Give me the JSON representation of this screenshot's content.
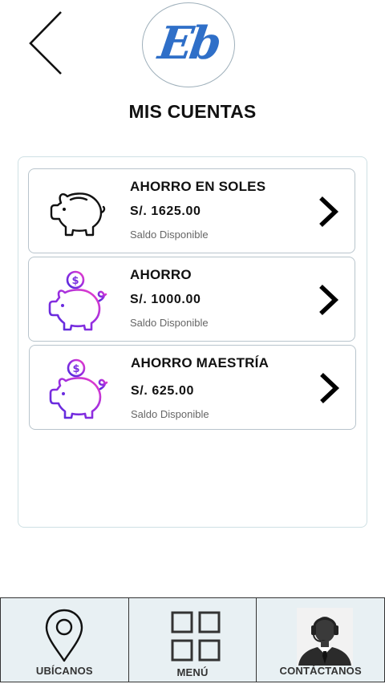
{
  "header": {
    "back_icon": "chevron-left-icon",
    "logo_text": "Eb",
    "title": "MIS CUENTAS"
  },
  "accounts": [
    {
      "name": "AHORRO EN SOLES",
      "amount": "S/.  1625.00",
      "caption": "Saldo Disponible",
      "icon": "piggy-bank-outline-icon"
    },
    {
      "name": "AHORRO",
      "amount": "S/.  1000.00",
      "caption": "Saldo Disponible",
      "icon": "piggy-bank-coin-icon"
    },
    {
      "name": "AHORRO MAESTRÍA",
      "amount": "S/. 625.00",
      "caption": "Saldo Disponible",
      "icon": "piggy-bank-coin-icon"
    }
  ],
  "bottom_nav": [
    {
      "label": "UBÍCANOS",
      "icon": "location-pin-icon"
    },
    {
      "label": "MENÚ",
      "icon": "grid-menu-icon"
    },
    {
      "label": "CONTÁCTANOS",
      "icon": "support-agent-icon"
    }
  ],
  "colors": {
    "logo_blue": "#2f6fc8",
    "icon_gradient_start": "#5b2bd6",
    "icon_gradient_end": "#e23ad0",
    "nav_background": "#e8f0f3"
  }
}
